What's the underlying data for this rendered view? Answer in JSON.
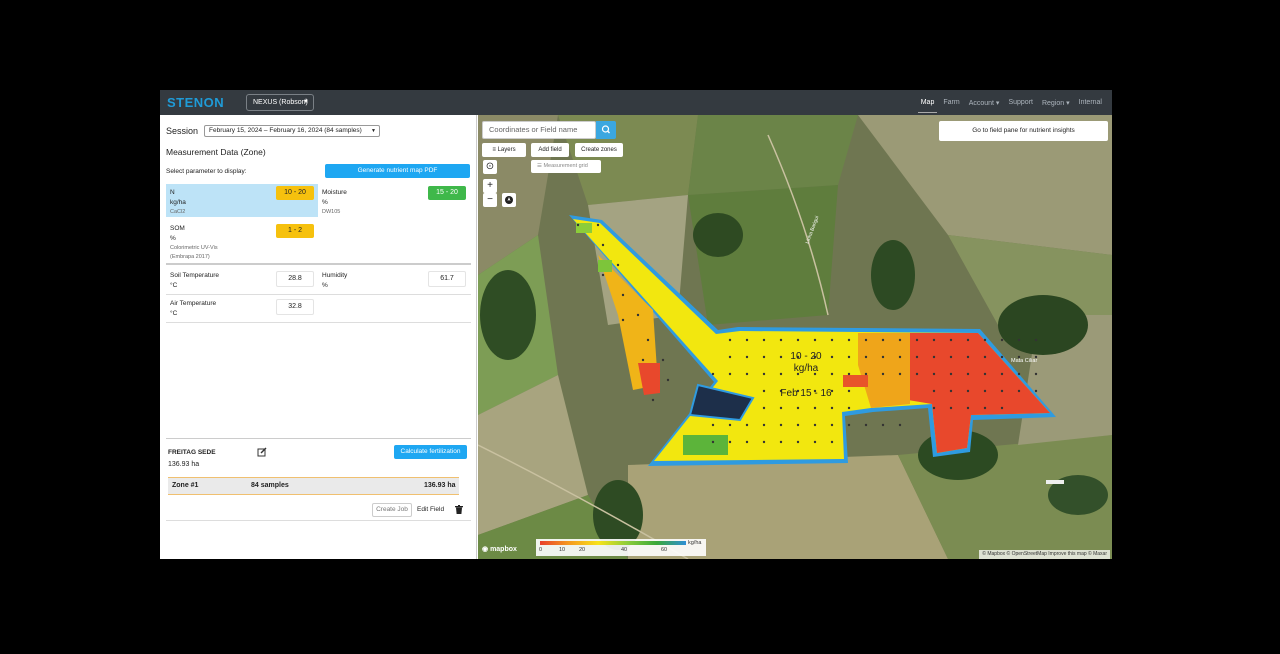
{
  "navbar": {
    "brand": "STENON",
    "org_select": "NEXUS (Robson)",
    "links": [
      "Map",
      "Farm",
      "Account",
      "Support",
      "Region",
      "Internal"
    ],
    "active": "Map"
  },
  "panel": {
    "session_label": "Session",
    "session_value": "February 15, 2024 – February 16, 2024 (84 samples)",
    "title": "Measurement Data (Zone)",
    "select_label": "Select parameter to display:",
    "pdf_button": "Generate nutrient map PDF",
    "params": {
      "n": {
        "name": "N",
        "unit": "kg/ha",
        "method": "CaCl2",
        "value": "10 - 20"
      },
      "moisture": {
        "name": "Moisture",
        "unit": "%",
        "method": "DW105",
        "value": "15 - 20"
      },
      "som": {
        "name": "SOM",
        "unit": "%",
        "method1": "Colorimetric UV-Vis",
        "method2": "(Embrapa 2017)",
        "value": "1 - 2"
      },
      "soil_temp": {
        "name": "Soil Temperature",
        "unit": "°C",
        "value": "28.8"
      },
      "humidity": {
        "name": "Humidity",
        "unit": "%",
        "value": "61.7"
      },
      "air_temp": {
        "name": "Air Temperature",
        "unit": "°C",
        "value": "32.8"
      }
    },
    "field": {
      "name": "FREITAG SEDE",
      "area": "136.93 ha",
      "calc_button": "Calculate fertilization",
      "zone": {
        "name": "Zone #1",
        "samples": "84 samples",
        "area": "136.93 ha"
      },
      "create_job": "Create Job",
      "edit_field": "Edit Field"
    }
  },
  "map": {
    "search_placeholder": "Coordinates or Field name",
    "layers_button": "Layers",
    "add_field_button": "Add field",
    "create_zones_button": "Create zones",
    "measurement_grid_button": "Measurement grid",
    "insights_button": "Go to field pane for nutrient insights",
    "zone_value": "10 - 20",
    "zone_unit": "kg/ha",
    "zone_date": "Feb 15 - 16",
    "road_label": "Linha Barigui",
    "place_label": "Mata Ciliar",
    "legend": {
      "unit": "kg/ha",
      "ticks": [
        "0",
        "10",
        "20",
        "40",
        "60"
      ],
      "colors": [
        "#e8402a",
        "#f59b1e",
        "#f7e31a",
        "#8ccc3a",
        "#3aa83a",
        "#2f8fd6"
      ]
    },
    "logo": "mapbox",
    "attribution": "© Mapbox © OpenStreetMap Improve this map © Maxar"
  }
}
